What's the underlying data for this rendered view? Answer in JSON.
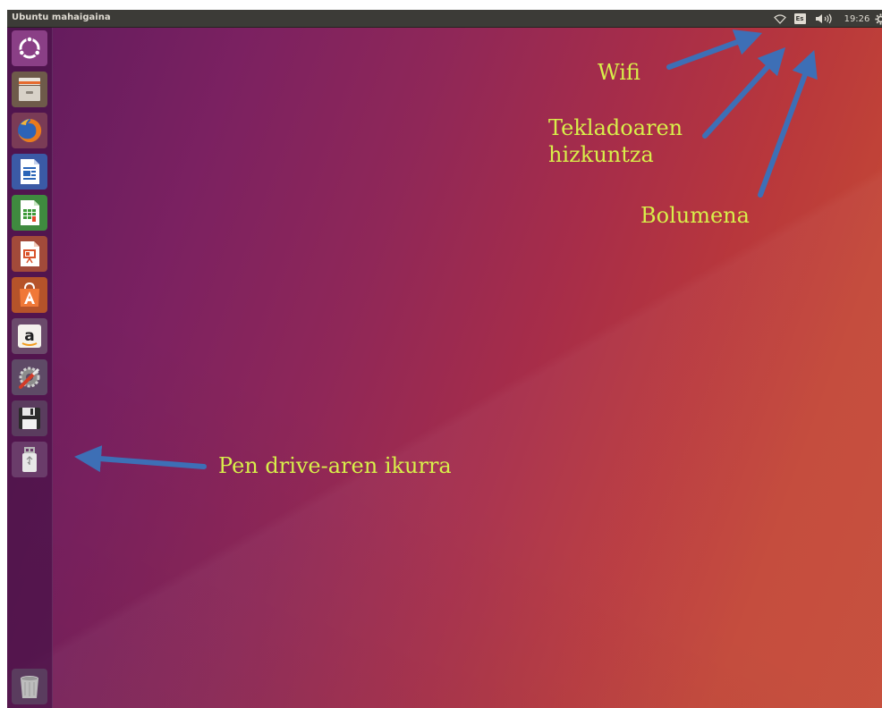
{
  "panel": {
    "title": "Ubuntu mahaigaina",
    "keyboard_layout": "Es",
    "clock": "19:26"
  },
  "launcher": {
    "items": [
      {
        "name": "ubuntu-dash",
        "icon": "ubuntu-logo-icon"
      },
      {
        "name": "files",
        "icon": "file-cabinet-icon"
      },
      {
        "name": "firefox",
        "icon": "firefox-icon"
      },
      {
        "name": "libreoffice-writer",
        "icon": "writer-document-icon"
      },
      {
        "name": "libreoffice-calc",
        "icon": "calc-spreadsheet-icon"
      },
      {
        "name": "libreoffice-impress",
        "icon": "impress-presentation-icon"
      },
      {
        "name": "ubuntu-software",
        "icon": "software-bag-icon"
      },
      {
        "name": "amazon",
        "icon": "amazon-icon"
      },
      {
        "name": "system-settings",
        "icon": "settings-wrench-gear-icon"
      },
      {
        "name": "floppy-disk",
        "icon": "floppy-disk-icon"
      },
      {
        "name": "usb-pen-drive",
        "icon": "usb-drive-icon"
      },
      {
        "name": "trash",
        "icon": "trash-icon"
      }
    ]
  },
  "annotations": {
    "wifi": "Wifi",
    "keyboard_line1": "Tekladoaren",
    "keyboard_line2": "hizkuntza",
    "volume": "Bolumena",
    "pen_drive": "Pen drive-aren ikurra"
  },
  "colors": {
    "panel_bg": "#3c3b37",
    "annotation_text": "#d8ef4a",
    "arrow": "#3d6fb6",
    "launcher_bg": "#4a1248"
  }
}
